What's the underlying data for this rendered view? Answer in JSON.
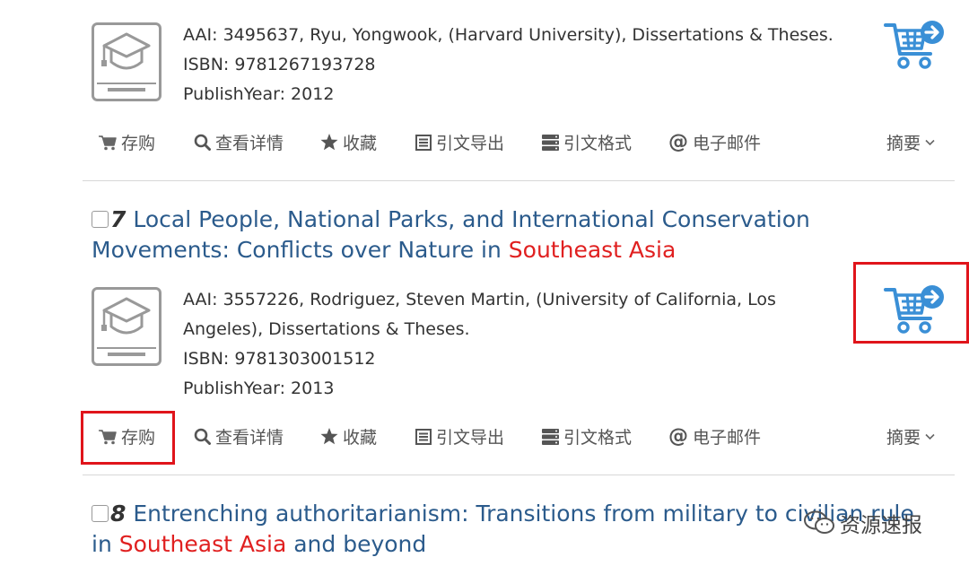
{
  "colors": {
    "link": "#2b5b8c",
    "highlight": "#e02020",
    "cart_blue": "#3a8fd6",
    "annotation_red": "#e0141b"
  },
  "records": [
    {
      "meta_lines": [
        "AAI: 3495637, Ryu, Yongwook, (Harvard University), Dissertations & Theses.",
        "ISBN: 9781267193728",
        "PublishYear: 2012"
      ]
    },
    {
      "number": "7",
      "title_plain": "Local People, National Parks, and International Conservation Movements: Conflicts over Nature in ",
      "title_highlight": "Southeast Asia",
      "meta_lines": [
        "AAI: 3557226, Rodriguez, Steven Martin, (University of California, Los",
        "Angeles), Dissertations & Theses.",
        "ISBN: 9781303001512",
        "PublishYear: 2013"
      ]
    },
    {
      "number": "8",
      "title_plain": "Entrenching authoritarianism: Transitions from military to civilian rule in ",
      "title_highlight": "Southeast Asia",
      "title_tail": " and beyond"
    }
  ],
  "actions": {
    "buy": "存购",
    "details": "查看详情",
    "favorite": "收藏",
    "export": "引文导出",
    "format": "引文格式",
    "email": "电子邮件",
    "abstract": "摘要"
  },
  "watermark": "资源速报"
}
